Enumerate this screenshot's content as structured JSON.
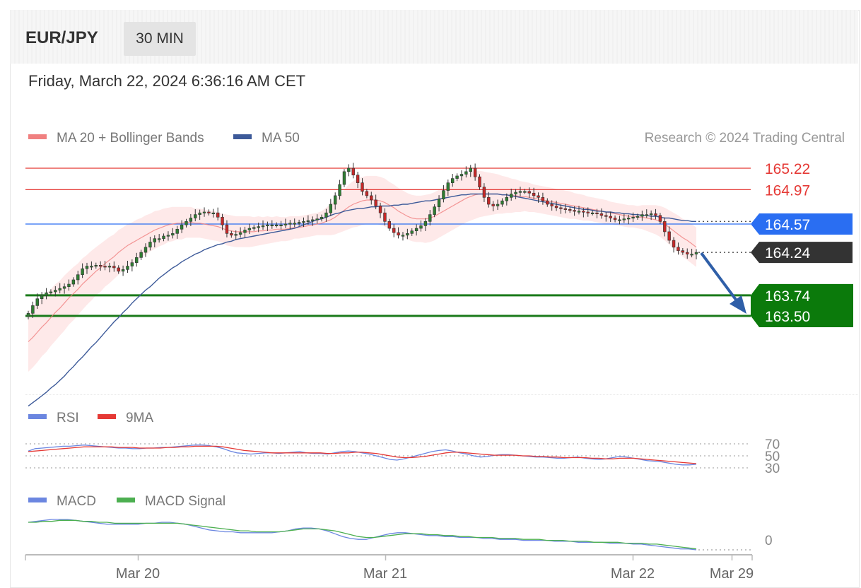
{
  "header": {
    "symbol": "EUR/JPY",
    "timeframe": "30 MIN"
  },
  "datetime": "Friday, March 22, 2024 6:36:16 AM CET",
  "colors": {
    "bb": "#f08080",
    "bb_band": "#fde2e2",
    "ma50": "#3d5a99",
    "resistance": "#e53935",
    "pivot": "#2a6ef2",
    "current": "#333333",
    "support": "#1a7a1a",
    "support_box": "#0b7a0b",
    "candle_up": "#2e7d32",
    "candle_down": "#c62828",
    "rsi": "#6b86e0",
    "rsi_ma": "#e53935",
    "macd": "#6b86e0",
    "macd_signal": "#4caf50",
    "arrow": "#2f5fa8"
  },
  "legend": {
    "bb_label": "MA 20 + Bollinger Bands",
    "ma50_label": "MA 50",
    "rsi_label": "RSI",
    "rsi_ma_label": "9MA",
    "macd_label": "MACD",
    "macd_signal_label": "MACD Signal"
  },
  "copyright": "Research © 2024 Trading Central",
  "chart_data": [
    {
      "type": "candlestick",
      "x_ticks": [
        "Mar 20",
        "Mar 21",
        "Mar 22",
        "Mar 29"
      ],
      "levels": [
        {
          "name": "resistance2",
          "value": 165.22,
          "label": "165.22"
        },
        {
          "name": "resistance1",
          "value": 164.97,
          "label": "164.97"
        },
        {
          "name": "pivot",
          "value": 164.57,
          "label": "164.57"
        },
        {
          "name": "current",
          "value": 164.24,
          "label": "164.24"
        },
        {
          "name": "support1",
          "value": 163.74,
          "label": "163.74"
        },
        {
          "name": "support2",
          "value": 163.5,
          "label": "163.50"
        }
      ],
      "close": [
        163.53,
        163.62,
        163.7,
        163.74,
        163.77,
        163.78,
        163.8,
        163.82,
        163.84,
        163.87,
        163.92,
        163.98,
        164.05,
        164.08,
        164.08,
        164.09,
        164.08,
        164.07,
        164.08,
        164.06,
        164.02,
        164.04,
        164.08,
        164.12,
        164.18,
        164.24,
        164.3,
        164.36,
        164.4,
        164.4,
        164.43,
        164.44,
        164.46,
        164.51,
        164.56,
        164.6,
        164.64,
        164.68,
        164.7,
        164.71,
        164.7,
        164.7,
        164.65,
        164.56,
        164.46,
        164.44,
        164.45,
        164.47,
        164.5,
        164.52,
        164.53,
        164.54,
        164.55,
        164.56,
        164.56,
        164.56,
        164.56,
        164.57,
        164.58,
        164.58,
        164.59,
        164.6,
        164.61,
        164.62,
        164.63,
        164.65,
        164.7,
        164.8,
        164.9,
        165.03,
        165.18,
        165.22,
        165.14,
        165.05,
        164.95,
        164.9,
        164.85,
        164.78,
        164.7,
        164.6,
        164.52,
        164.47,
        164.44,
        164.44,
        164.46,
        164.49,
        164.52,
        164.55,
        164.6,
        164.68,
        164.77,
        164.86,
        164.96,
        165.05,
        165.1,
        165.13,
        165.15,
        165.18,
        165.22,
        165.12,
        165.0,
        164.88,
        164.8,
        164.78,
        164.8,
        164.84,
        164.88,
        164.92,
        164.94,
        164.95,
        164.95,
        164.93,
        164.9,
        164.88,
        164.84,
        164.8,
        164.78,
        164.76,
        164.75,
        164.74,
        164.73,
        164.72,
        164.72,
        164.71,
        164.7,
        164.7,
        164.69,
        164.67,
        164.66,
        164.64,
        164.62,
        164.62,
        164.63,
        164.64,
        164.65,
        164.66,
        164.68,
        164.68,
        164.69,
        164.67,
        164.6,
        164.48,
        164.38,
        164.3,
        164.26,
        164.24,
        164.22,
        164.22,
        164.24
      ],
      "ma20": [
        163.2,
        163.25,
        163.31,
        163.37,
        163.42,
        163.48,
        163.54,
        163.59,
        163.65,
        163.71,
        163.76,
        163.81,
        163.87,
        163.92,
        163.97,
        164.02,
        164.06,
        164.11,
        164.15,
        164.19,
        164.24,
        164.28,
        164.32,
        164.35,
        164.38,
        164.41,
        164.44,
        164.47,
        164.5,
        164.52,
        164.54,
        164.56,
        164.57,
        164.58,
        164.58,
        164.59,
        164.59,
        164.58,
        164.58,
        164.57,
        164.56,
        164.55,
        164.54,
        164.52,
        164.5,
        164.49,
        164.48,
        164.48,
        164.48,
        164.48,
        164.48,
        164.49,
        164.49,
        164.5,
        164.5,
        164.51,
        164.51,
        164.51,
        164.52,
        164.53,
        164.53,
        164.54,
        164.55,
        164.56,
        164.57,
        164.58,
        164.6,
        164.62,
        164.65,
        164.69,
        164.73,
        164.77,
        164.8,
        164.82,
        164.84,
        164.85,
        164.85,
        164.85,
        164.84,
        164.82,
        164.79,
        164.76,
        164.72,
        164.69,
        164.66,
        164.64,
        164.63,
        164.63,
        164.63,
        164.64,
        164.66,
        164.69,
        164.72,
        164.75,
        164.78,
        164.81,
        164.84,
        164.87,
        164.89,
        164.91,
        164.92,
        164.92,
        164.92,
        164.92,
        164.92,
        164.91,
        164.91,
        164.9,
        164.9,
        164.89,
        164.89,
        164.88,
        164.87,
        164.86,
        164.85,
        164.84,
        164.83,
        164.82,
        164.81,
        164.8,
        164.79,
        164.78,
        164.77,
        164.76,
        164.75,
        164.74,
        164.73,
        164.72,
        164.71,
        164.7,
        164.69,
        164.68,
        164.67,
        164.66,
        164.66,
        164.65,
        164.65,
        164.64,
        164.63,
        164.62,
        164.6,
        164.57,
        164.53,
        164.49,
        164.45,
        164.41,
        164.38,
        164.34,
        164.3
      ],
      "ma50": [
        162.45,
        162.49,
        162.53,
        162.57,
        162.61,
        162.66,
        162.7,
        162.75,
        162.8,
        162.86,
        162.91,
        162.97,
        163.02,
        163.08,
        163.14,
        163.19,
        163.25,
        163.31,
        163.37,
        163.43,
        163.48,
        163.54,
        163.59,
        163.65,
        163.7,
        163.75,
        163.8,
        163.84,
        163.89,
        163.94,
        163.98,
        164.02,
        164.06,
        164.09,
        164.13,
        164.16,
        164.19,
        164.22,
        164.24,
        164.27,
        164.29,
        164.31,
        164.33,
        164.34,
        164.36,
        164.37,
        164.39,
        164.4,
        164.41,
        164.42,
        164.43,
        164.44,
        164.45,
        164.46,
        164.47,
        164.48,
        164.49,
        164.5,
        164.51,
        164.52,
        164.54,
        164.56,
        164.58,
        164.6,
        164.62,
        164.63,
        164.65,
        164.67,
        164.69,
        164.7,
        164.72,
        164.73,
        164.74,
        164.75,
        164.75,
        164.76,
        164.77,
        164.77,
        164.78,
        164.78,
        164.78,
        164.79,
        164.79,
        164.8,
        164.8,
        164.81,
        164.82,
        164.83,
        164.84,
        164.84,
        164.85,
        164.86,
        164.87,
        164.88,
        164.89,
        164.9,
        164.91,
        164.91,
        164.92,
        164.92,
        164.92,
        164.92,
        164.92,
        164.92,
        164.92,
        164.91,
        164.91,
        164.9,
        164.89,
        164.88,
        164.87,
        164.86,
        164.85,
        164.84,
        164.83,
        164.82,
        164.81,
        164.8,
        164.79,
        164.78,
        164.77,
        164.76,
        164.75,
        164.74,
        164.74,
        164.73,
        164.72,
        164.72,
        164.71,
        164.71,
        164.7,
        164.7,
        164.69,
        164.69,
        164.68,
        164.68,
        164.67,
        164.67,
        164.66,
        164.66,
        164.65,
        164.64,
        164.64,
        164.63,
        164.62,
        164.61,
        164.61,
        164.6,
        164.6
      ],
      "bb_width": [
        0.35,
        0.35,
        0.35,
        0.34,
        0.34,
        0.33,
        0.33,
        0.32,
        0.32,
        0.31,
        0.31,
        0.3,
        0.3,
        0.29,
        0.29,
        0.28,
        0.28,
        0.27,
        0.27,
        0.26,
        0.26,
        0.25,
        0.25,
        0.24,
        0.24,
        0.23,
        0.23,
        0.22,
        0.22,
        0.21,
        0.21,
        0.2,
        0.2,
        0.19,
        0.19,
        0.18,
        0.18,
        0.17,
        0.17,
        0.17,
        0.17,
        0.17,
        0.17,
        0.17,
        0.18,
        0.18,
        0.18,
        0.18,
        0.18,
        0.18,
        0.17,
        0.17,
        0.16,
        0.16,
        0.15,
        0.15,
        0.14,
        0.14,
        0.14,
        0.13,
        0.13,
        0.13,
        0.13,
        0.13,
        0.13,
        0.14,
        0.16,
        0.18,
        0.2,
        0.22,
        0.24,
        0.26,
        0.27,
        0.28,
        0.28,
        0.28,
        0.28,
        0.28,
        0.28,
        0.28,
        0.27,
        0.27,
        0.27,
        0.27,
        0.27,
        0.27,
        0.27,
        0.27,
        0.28,
        0.28,
        0.28,
        0.28,
        0.28,
        0.28,
        0.28,
        0.28,
        0.28,
        0.28,
        0.28,
        0.28,
        0.27,
        0.26,
        0.25,
        0.24,
        0.23,
        0.22,
        0.21,
        0.2,
        0.19,
        0.18,
        0.17,
        0.17,
        0.16,
        0.16,
        0.16,
        0.16,
        0.16,
        0.16,
        0.16,
        0.16,
        0.16,
        0.15,
        0.15,
        0.15,
        0.14,
        0.14,
        0.14,
        0.14,
        0.14,
        0.13,
        0.13,
        0.13,
        0.13,
        0.13,
        0.13,
        0.13,
        0.14,
        0.15,
        0.16,
        0.17,
        0.18,
        0.19,
        0.2,
        0.21,
        0.22,
        0.22,
        0.23,
        0.23,
        0.23
      ]
    },
    {
      "type": "line",
      "name": "RSI panel",
      "y_ticks": [
        "70",
        "50",
        "30"
      ],
      "rsi": [
        58,
        62,
        63,
        64,
        65,
        66,
        66,
        67,
        68,
        67,
        66,
        65,
        64,
        63,
        63,
        62,
        62,
        63,
        63,
        64,
        64,
        65,
        66,
        67,
        68,
        68,
        67,
        65,
        62,
        58,
        55,
        54,
        53,
        54,
        55,
        55,
        54,
        55,
        56,
        57,
        55,
        54,
        54,
        53,
        55,
        57,
        58,
        57,
        55,
        53,
        50,
        47,
        44,
        43,
        45,
        48,
        51,
        54,
        57,
        59,
        60,
        58,
        55,
        53,
        50,
        48,
        49,
        51,
        52,
        52,
        51,
        50,
        49,
        48,
        48,
        47,
        46,
        46,
        47,
        48,
        46,
        45,
        44,
        45,
        47,
        49,
        48,
        46,
        44,
        42,
        41,
        40,
        38,
        36,
        35,
        35,
        36
      ],
      "rsi_ma": [
        57,
        58,
        59,
        60,
        61,
        62,
        63,
        64,
        65,
        65,
        65,
        65,
        65,
        64,
        64,
        64,
        63,
        63,
        63,
        63,
        64,
        64,
        65,
        65,
        66,
        66,
        66,
        66,
        65,
        63,
        61,
        59,
        58,
        57,
        56,
        55,
        55,
        55,
        55,
        55,
        55,
        55,
        55,
        54,
        54,
        55,
        55,
        56,
        56,
        55,
        54,
        52,
        50,
        48,
        47,
        47,
        48,
        49,
        51,
        53,
        55,
        56,
        56,
        55,
        54,
        53,
        52,
        51,
        51,
        51,
        51,
        50,
        50,
        49,
        49,
        48,
        48,
        47,
        47,
        47,
        47,
        46,
        46,
        45,
        45,
        46,
        46,
        46,
        45,
        44,
        43,
        42,
        41,
        40,
        39,
        38,
        37
      ]
    },
    {
      "type": "line",
      "name": "MACD panel",
      "y_ticks": [
        "0"
      ],
      "macd": [
        0.18,
        0.19,
        0.2,
        0.21,
        0.21,
        0.21,
        0.2,
        0.19,
        0.18,
        0.17,
        0.16,
        0.16,
        0.16,
        0.16,
        0.16,
        0.17,
        0.17,
        0.18,
        0.18,
        0.17,
        0.16,
        0.14,
        0.12,
        0.1,
        0.09,
        0.08,
        0.08,
        0.07,
        0.07,
        0.07,
        0.07,
        0.07,
        0.08,
        0.09,
        0.11,
        0.12,
        0.12,
        0.11,
        0.09,
        0.06,
        0.03,
        0.01,
        0.0,
        0.0,
        0.02,
        0.04,
        0.06,
        0.07,
        0.07,
        0.06,
        0.05,
        0.04,
        0.04,
        0.03,
        0.03,
        0.02,
        0.02,
        0.02,
        0.01,
        0.01,
        0.0,
        0.0,
        0.0,
        -0.01,
        -0.01,
        -0.01,
        -0.01,
        -0.02,
        -0.02,
        -0.02,
        -0.03,
        -0.03,
        -0.03,
        -0.03,
        -0.04,
        -0.04,
        -0.04,
        -0.05,
        -0.05,
        -0.06,
        -0.07,
        -0.08,
        -0.09,
        -0.1,
        -0.1,
        -0.11
      ],
      "macd_signal": [
        0.18,
        0.18,
        0.19,
        0.19,
        0.2,
        0.2,
        0.2,
        0.19,
        0.19,
        0.18,
        0.18,
        0.17,
        0.17,
        0.17,
        0.17,
        0.17,
        0.17,
        0.17,
        0.17,
        0.17,
        0.16,
        0.15,
        0.14,
        0.13,
        0.12,
        0.11,
        0.1,
        0.09,
        0.09,
        0.08,
        0.08,
        0.08,
        0.08,
        0.09,
        0.1,
        0.11,
        0.11,
        0.11,
        0.1,
        0.09,
        0.07,
        0.05,
        0.03,
        0.02,
        0.02,
        0.03,
        0.04,
        0.05,
        0.06,
        0.06,
        0.06,
        0.05,
        0.05,
        0.04,
        0.04,
        0.03,
        0.03,
        0.02,
        0.02,
        0.02,
        0.01,
        0.01,
        0.01,
        0.0,
        0.0,
        0.0,
        -0.01,
        -0.01,
        -0.01,
        -0.02,
        -0.02,
        -0.02,
        -0.03,
        -0.03,
        -0.03,
        -0.03,
        -0.04,
        -0.04,
        -0.04,
        -0.05,
        -0.05,
        -0.06,
        -0.07,
        -0.08,
        -0.09,
        -0.1
      ]
    }
  ]
}
